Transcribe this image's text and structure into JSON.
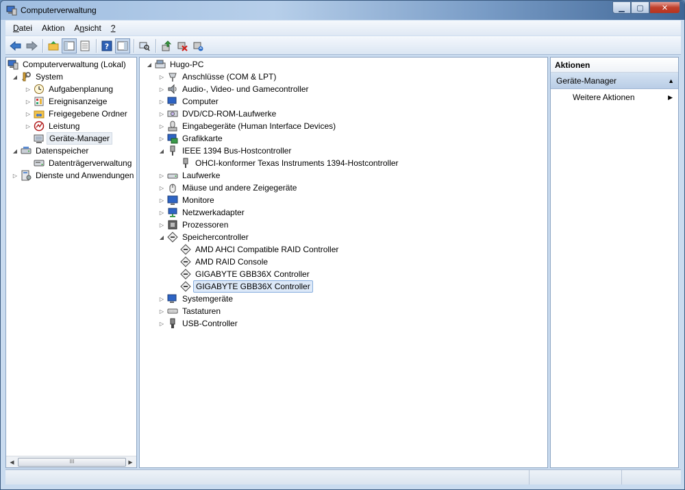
{
  "window": {
    "title": "Computerverwaltung"
  },
  "menu": [
    {
      "label": "Datei",
      "accel": "D"
    },
    {
      "label": "Aktion",
      "accel": "A"
    },
    {
      "label": "Ansicht",
      "accel": "n"
    },
    {
      "label": "?",
      "accel": "?"
    }
  ],
  "toolbar": [
    "back-icon",
    "forward-icon",
    "up-folder-icon",
    "show-hide-tree-icon",
    "properties-icon",
    "help-icon",
    "show-hide-action-icon",
    "scan-hardware-icon",
    "update-driver-icon",
    "disable-device-icon",
    "uninstall-device-icon"
  ],
  "left_tree": {
    "root": "Computerverwaltung (Lokal)",
    "items": [
      {
        "label": "System",
        "level": 1,
        "expanded": true,
        "icon": "tools-icon"
      },
      {
        "label": "Aufgabenplanung",
        "level": 2,
        "icon": "clock-icon"
      },
      {
        "label": "Ereignisanzeige",
        "level": 2,
        "icon": "event-viewer-icon"
      },
      {
        "label": "Freigegebene Ordner",
        "level": 2,
        "icon": "shared-folder-icon"
      },
      {
        "label": "Leistung",
        "level": 2,
        "icon": "performance-icon"
      },
      {
        "label": "Geräte-Manager",
        "level": 2,
        "icon": "device-manager-icon",
        "selected": true
      },
      {
        "label": "Datenspeicher",
        "level": 1,
        "expanded": true,
        "icon": "storage-icon"
      },
      {
        "label": "Datenträgerverwaltung",
        "level": 2,
        "icon": "disk-management-icon"
      },
      {
        "label": "Dienste und Anwendungen",
        "level": 1,
        "icon": "services-icon"
      }
    ],
    "scroll_glyph": "III"
  },
  "device_tree": {
    "root": "Hugo-PC",
    "items": [
      {
        "label": "Anschlüsse (COM & LPT)",
        "level": 1,
        "icon": "port-icon"
      },
      {
        "label": "Audio-, Video- und Gamecontroller",
        "level": 1,
        "icon": "audio-icon"
      },
      {
        "label": "Computer",
        "level": 1,
        "icon": "computer-icon"
      },
      {
        "label": "DVD/CD-ROM-Laufwerke",
        "level": 1,
        "icon": "dvd-drive-icon"
      },
      {
        "label": "Eingabegeräte (Human Interface Devices)",
        "level": 1,
        "icon": "hid-icon"
      },
      {
        "label": "Grafikkarte",
        "level": 1,
        "icon": "display-adapter-icon"
      },
      {
        "label": "IEEE 1394 Bus-Hostcontroller",
        "level": 1,
        "icon": "firewire-icon",
        "expanded": true
      },
      {
        "label": "OHCI-konformer Texas Instruments 1394-Hostcontroller",
        "level": 2,
        "icon": "firewire-icon"
      },
      {
        "label": "Laufwerke",
        "level": 1,
        "icon": "disk-drive-icon"
      },
      {
        "label": "Mäuse und andere Zeigegeräte",
        "level": 1,
        "icon": "mouse-icon"
      },
      {
        "label": "Monitore",
        "level": 1,
        "icon": "monitor-icon"
      },
      {
        "label": "Netzwerkadapter",
        "level": 1,
        "icon": "network-adapter-icon"
      },
      {
        "label": "Prozessoren",
        "level": 1,
        "icon": "processor-icon"
      },
      {
        "label": "Speichercontroller",
        "level": 1,
        "icon": "storage-controller-icon",
        "expanded": true
      },
      {
        "label": "AMD AHCI Compatible RAID Controller",
        "level": 2,
        "icon": "storage-controller-icon"
      },
      {
        "label": "AMD RAID Console",
        "level": 2,
        "icon": "storage-controller-icon"
      },
      {
        "label": "GIGABYTE GBB36X Controller",
        "level": 2,
        "icon": "storage-controller-icon"
      },
      {
        "label": "GIGABYTE GBB36X Controller",
        "level": 2,
        "icon": "storage-controller-icon",
        "selected": true
      },
      {
        "label": "Systemgeräte",
        "level": 1,
        "icon": "system-devices-icon"
      },
      {
        "label": "Tastaturen",
        "level": 1,
        "icon": "keyboard-icon"
      },
      {
        "label": "USB-Controller",
        "level": 1,
        "icon": "usb-icon"
      }
    ]
  },
  "actions": {
    "header": "Aktionen",
    "section": "Geräte-Manager",
    "item": "Weitere Aktionen"
  },
  "colors": {
    "selection_fill": "#dde9f8",
    "selection_border": "#84acdd",
    "actions_section": "#c6d7ec"
  }
}
